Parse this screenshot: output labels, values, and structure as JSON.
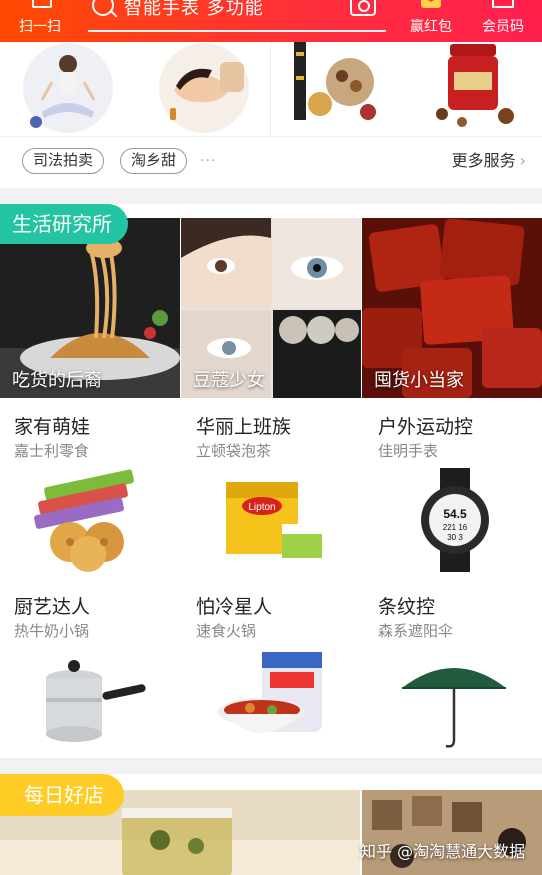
{
  "topbar": {
    "scan_label": "扫一扫",
    "search_placeholder": "智能手表 多功能",
    "hongbao_label": "赢红包",
    "member_label": "会员码"
  },
  "services": {
    "tags": [
      "司法拍卖",
      "淘乡甜"
    ],
    "ellipsis": "···",
    "more_label": "更多服务",
    "more_chevron": "›"
  },
  "life": {
    "badge": "生活研究所",
    "banners": [
      {
        "caption": "吃货的后裔"
      },
      {
        "caption": "豆蔻少女"
      },
      {
        "caption": "囤货小当家"
      }
    ],
    "cells": [
      {
        "title": "家有萌娃",
        "subtitle": "嘉士利零食"
      },
      {
        "title": "华丽上班族",
        "subtitle": "立顿袋泡茶"
      },
      {
        "title": "户外运动控",
        "subtitle": "佳明手表"
      },
      {
        "title": "厨艺达人",
        "subtitle": "热牛奶小锅"
      },
      {
        "title": "怕冷星人",
        "subtitle": "速食火锅"
      },
      {
        "title": "条纹控",
        "subtitle": "森系遮阳伞"
      }
    ],
    "product_text": {
      "lipton": "Lipton",
      "watch_time": "54.5",
      "watch_sub": "221 16",
      "watch_bottom": "30 3"
    }
  },
  "shop": {
    "badge": "每日好店"
  },
  "watermark": "知乎 @淘淘慧通大数据",
  "colors": {
    "topbar": "#ff3a2a",
    "life_badge": "#22c4a2",
    "shop_badge": "#ffcc26"
  }
}
